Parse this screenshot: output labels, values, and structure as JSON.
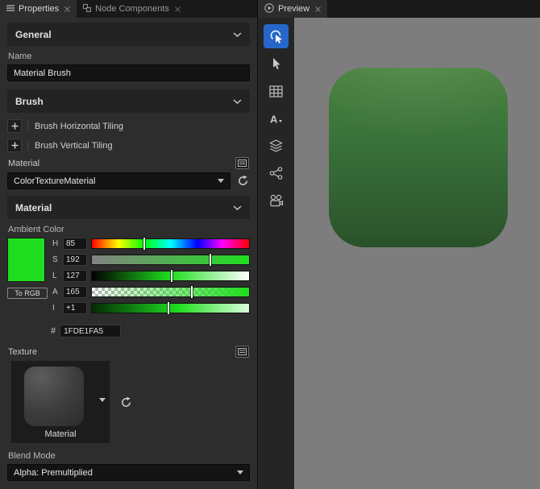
{
  "left_tabs": [
    {
      "label": "Properties"
    },
    {
      "label": "Node Components"
    }
  ],
  "preview_tab": {
    "label": "Preview"
  },
  "general": {
    "title": "General",
    "name_label": "Name",
    "name_value": "Material Brush"
  },
  "brush": {
    "title": "Brush",
    "tiling_rows": [
      {
        "label": "Brush Horizontal Tiling"
      },
      {
        "label": "Brush Vertical Tiling"
      }
    ],
    "material_label": "Material",
    "material_value": "ColorTextureMaterial"
  },
  "material": {
    "title": "Material",
    "ambient_label": "Ambient Color",
    "channels": [
      {
        "key": "H",
        "value": "85"
      },
      {
        "key": "S",
        "value": "192"
      },
      {
        "key": "L",
        "value": "127"
      },
      {
        "key": "A",
        "value": "165"
      },
      {
        "key": "I",
        "value": "+1"
      }
    ],
    "to_rgb_label": "To RGB",
    "hex_prefix": "#",
    "hex_value": "1FDE1FA5",
    "swatch_color": "#1FDE1F",
    "texture_label": "Texture",
    "texture_name": "Material",
    "blend_label": "Blend Mode",
    "blend_value": "Alpha: Premultiplied"
  },
  "colors": {
    "accent_blue": "#2667c9",
    "preview_background": "#7d7d7d",
    "preview_square_top": "#47813c",
    "preview_square_bottom": "#2a5129"
  }
}
